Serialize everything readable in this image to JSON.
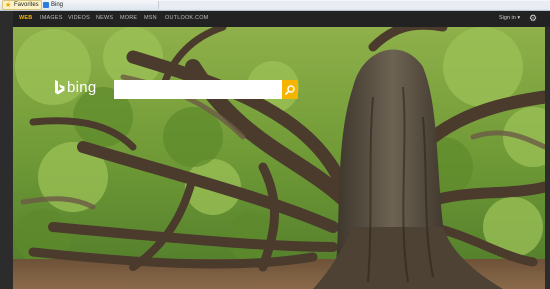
{
  "favorites_bar": {
    "favorites_label": "Favorites",
    "bing_label": "Bing"
  },
  "nav": {
    "items": [
      "WEB",
      "IMAGES",
      "VIDEOS",
      "NEWS",
      "MORE",
      "MSN",
      "OUTLOOK.COM"
    ],
    "signin_label": "Sign in",
    "signin_caret": "▾"
  },
  "search": {
    "logo_text": "bing",
    "placeholder": "",
    "value": ""
  },
  "colors": {
    "accent": "#f4b400",
    "nav_bg": "#222222",
    "nav_active": "#f2b600"
  }
}
